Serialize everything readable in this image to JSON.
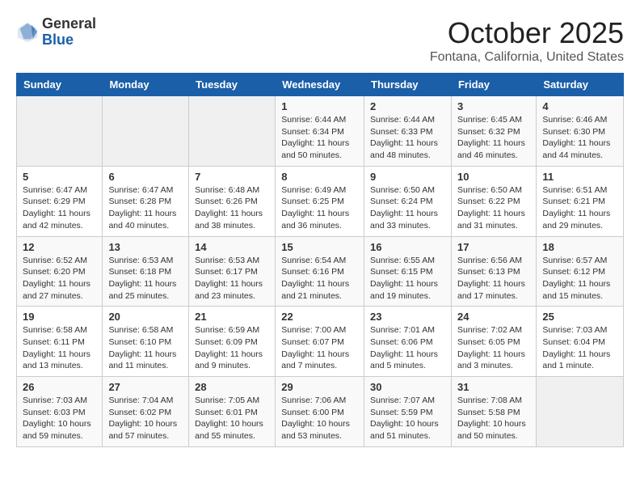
{
  "header": {
    "logo_general": "General",
    "logo_blue": "Blue",
    "month": "October 2025",
    "location": "Fontana, California, United States"
  },
  "days_of_week": [
    "Sunday",
    "Monday",
    "Tuesday",
    "Wednesday",
    "Thursday",
    "Friday",
    "Saturday"
  ],
  "weeks": [
    [
      {
        "day": "",
        "info": ""
      },
      {
        "day": "",
        "info": ""
      },
      {
        "day": "",
        "info": ""
      },
      {
        "day": "1",
        "info": "Sunrise: 6:44 AM\nSunset: 6:34 PM\nDaylight: 11 hours\nand 50 minutes."
      },
      {
        "day": "2",
        "info": "Sunrise: 6:44 AM\nSunset: 6:33 PM\nDaylight: 11 hours\nand 48 minutes."
      },
      {
        "day": "3",
        "info": "Sunrise: 6:45 AM\nSunset: 6:32 PM\nDaylight: 11 hours\nand 46 minutes."
      },
      {
        "day": "4",
        "info": "Sunrise: 6:46 AM\nSunset: 6:30 PM\nDaylight: 11 hours\nand 44 minutes."
      }
    ],
    [
      {
        "day": "5",
        "info": "Sunrise: 6:47 AM\nSunset: 6:29 PM\nDaylight: 11 hours\nand 42 minutes."
      },
      {
        "day": "6",
        "info": "Sunrise: 6:47 AM\nSunset: 6:28 PM\nDaylight: 11 hours\nand 40 minutes."
      },
      {
        "day": "7",
        "info": "Sunrise: 6:48 AM\nSunset: 6:26 PM\nDaylight: 11 hours\nand 38 minutes."
      },
      {
        "day": "8",
        "info": "Sunrise: 6:49 AM\nSunset: 6:25 PM\nDaylight: 11 hours\nand 36 minutes."
      },
      {
        "day": "9",
        "info": "Sunrise: 6:50 AM\nSunset: 6:24 PM\nDaylight: 11 hours\nand 33 minutes."
      },
      {
        "day": "10",
        "info": "Sunrise: 6:50 AM\nSunset: 6:22 PM\nDaylight: 11 hours\nand 31 minutes."
      },
      {
        "day": "11",
        "info": "Sunrise: 6:51 AM\nSunset: 6:21 PM\nDaylight: 11 hours\nand 29 minutes."
      }
    ],
    [
      {
        "day": "12",
        "info": "Sunrise: 6:52 AM\nSunset: 6:20 PM\nDaylight: 11 hours\nand 27 minutes."
      },
      {
        "day": "13",
        "info": "Sunrise: 6:53 AM\nSunset: 6:18 PM\nDaylight: 11 hours\nand 25 minutes."
      },
      {
        "day": "14",
        "info": "Sunrise: 6:53 AM\nSunset: 6:17 PM\nDaylight: 11 hours\nand 23 minutes."
      },
      {
        "day": "15",
        "info": "Sunrise: 6:54 AM\nSunset: 6:16 PM\nDaylight: 11 hours\nand 21 minutes."
      },
      {
        "day": "16",
        "info": "Sunrise: 6:55 AM\nSunset: 6:15 PM\nDaylight: 11 hours\nand 19 minutes."
      },
      {
        "day": "17",
        "info": "Sunrise: 6:56 AM\nSunset: 6:13 PM\nDaylight: 11 hours\nand 17 minutes."
      },
      {
        "day": "18",
        "info": "Sunrise: 6:57 AM\nSunset: 6:12 PM\nDaylight: 11 hours\nand 15 minutes."
      }
    ],
    [
      {
        "day": "19",
        "info": "Sunrise: 6:58 AM\nSunset: 6:11 PM\nDaylight: 11 hours\nand 13 minutes."
      },
      {
        "day": "20",
        "info": "Sunrise: 6:58 AM\nSunset: 6:10 PM\nDaylight: 11 hours\nand 11 minutes."
      },
      {
        "day": "21",
        "info": "Sunrise: 6:59 AM\nSunset: 6:09 PM\nDaylight: 11 hours\nand 9 minutes."
      },
      {
        "day": "22",
        "info": "Sunrise: 7:00 AM\nSunset: 6:07 PM\nDaylight: 11 hours\nand 7 minutes."
      },
      {
        "day": "23",
        "info": "Sunrise: 7:01 AM\nSunset: 6:06 PM\nDaylight: 11 hours\nand 5 minutes."
      },
      {
        "day": "24",
        "info": "Sunrise: 7:02 AM\nSunset: 6:05 PM\nDaylight: 11 hours\nand 3 minutes."
      },
      {
        "day": "25",
        "info": "Sunrise: 7:03 AM\nSunset: 6:04 PM\nDaylight: 11 hours\nand 1 minute."
      }
    ],
    [
      {
        "day": "26",
        "info": "Sunrise: 7:03 AM\nSunset: 6:03 PM\nDaylight: 10 hours\nand 59 minutes."
      },
      {
        "day": "27",
        "info": "Sunrise: 7:04 AM\nSunset: 6:02 PM\nDaylight: 10 hours\nand 57 minutes."
      },
      {
        "day": "28",
        "info": "Sunrise: 7:05 AM\nSunset: 6:01 PM\nDaylight: 10 hours\nand 55 minutes."
      },
      {
        "day": "29",
        "info": "Sunrise: 7:06 AM\nSunset: 6:00 PM\nDaylight: 10 hours\nand 53 minutes."
      },
      {
        "day": "30",
        "info": "Sunrise: 7:07 AM\nSunset: 5:59 PM\nDaylight: 10 hours\nand 51 minutes."
      },
      {
        "day": "31",
        "info": "Sunrise: 7:08 AM\nSunset: 5:58 PM\nDaylight: 10 hours\nand 50 minutes."
      },
      {
        "day": "",
        "info": ""
      }
    ]
  ]
}
